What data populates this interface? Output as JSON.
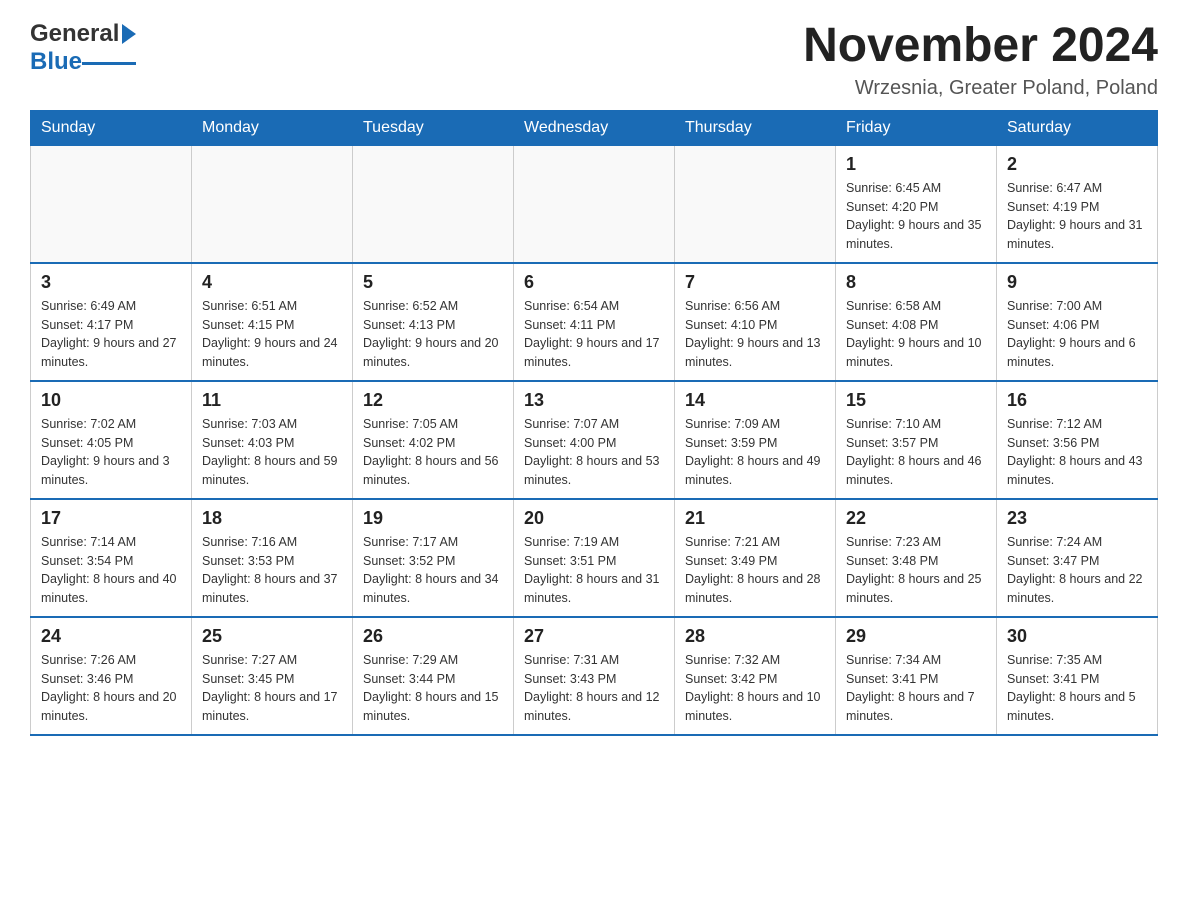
{
  "header": {
    "logo_general": "General",
    "logo_blue": "Blue",
    "title": "November 2024",
    "subtitle": "Wrzesnia, Greater Poland, Poland"
  },
  "weekdays": [
    "Sunday",
    "Monday",
    "Tuesday",
    "Wednesday",
    "Thursday",
    "Friday",
    "Saturday"
  ],
  "weeks": [
    [
      {
        "day": "",
        "info": ""
      },
      {
        "day": "",
        "info": ""
      },
      {
        "day": "",
        "info": ""
      },
      {
        "day": "",
        "info": ""
      },
      {
        "day": "",
        "info": ""
      },
      {
        "day": "1",
        "info": "Sunrise: 6:45 AM\nSunset: 4:20 PM\nDaylight: 9 hours and 35 minutes."
      },
      {
        "day": "2",
        "info": "Sunrise: 6:47 AM\nSunset: 4:19 PM\nDaylight: 9 hours and 31 minutes."
      }
    ],
    [
      {
        "day": "3",
        "info": "Sunrise: 6:49 AM\nSunset: 4:17 PM\nDaylight: 9 hours and 27 minutes."
      },
      {
        "day": "4",
        "info": "Sunrise: 6:51 AM\nSunset: 4:15 PM\nDaylight: 9 hours and 24 minutes."
      },
      {
        "day": "5",
        "info": "Sunrise: 6:52 AM\nSunset: 4:13 PM\nDaylight: 9 hours and 20 minutes."
      },
      {
        "day": "6",
        "info": "Sunrise: 6:54 AM\nSunset: 4:11 PM\nDaylight: 9 hours and 17 minutes."
      },
      {
        "day": "7",
        "info": "Sunrise: 6:56 AM\nSunset: 4:10 PM\nDaylight: 9 hours and 13 minutes."
      },
      {
        "day": "8",
        "info": "Sunrise: 6:58 AM\nSunset: 4:08 PM\nDaylight: 9 hours and 10 minutes."
      },
      {
        "day": "9",
        "info": "Sunrise: 7:00 AM\nSunset: 4:06 PM\nDaylight: 9 hours and 6 minutes."
      }
    ],
    [
      {
        "day": "10",
        "info": "Sunrise: 7:02 AM\nSunset: 4:05 PM\nDaylight: 9 hours and 3 minutes."
      },
      {
        "day": "11",
        "info": "Sunrise: 7:03 AM\nSunset: 4:03 PM\nDaylight: 8 hours and 59 minutes."
      },
      {
        "day": "12",
        "info": "Sunrise: 7:05 AM\nSunset: 4:02 PM\nDaylight: 8 hours and 56 minutes."
      },
      {
        "day": "13",
        "info": "Sunrise: 7:07 AM\nSunset: 4:00 PM\nDaylight: 8 hours and 53 minutes."
      },
      {
        "day": "14",
        "info": "Sunrise: 7:09 AM\nSunset: 3:59 PM\nDaylight: 8 hours and 49 minutes."
      },
      {
        "day": "15",
        "info": "Sunrise: 7:10 AM\nSunset: 3:57 PM\nDaylight: 8 hours and 46 minutes."
      },
      {
        "day": "16",
        "info": "Sunrise: 7:12 AM\nSunset: 3:56 PM\nDaylight: 8 hours and 43 minutes."
      }
    ],
    [
      {
        "day": "17",
        "info": "Sunrise: 7:14 AM\nSunset: 3:54 PM\nDaylight: 8 hours and 40 minutes."
      },
      {
        "day": "18",
        "info": "Sunrise: 7:16 AM\nSunset: 3:53 PM\nDaylight: 8 hours and 37 minutes."
      },
      {
        "day": "19",
        "info": "Sunrise: 7:17 AM\nSunset: 3:52 PM\nDaylight: 8 hours and 34 minutes."
      },
      {
        "day": "20",
        "info": "Sunrise: 7:19 AM\nSunset: 3:51 PM\nDaylight: 8 hours and 31 minutes."
      },
      {
        "day": "21",
        "info": "Sunrise: 7:21 AM\nSunset: 3:49 PM\nDaylight: 8 hours and 28 minutes."
      },
      {
        "day": "22",
        "info": "Sunrise: 7:23 AM\nSunset: 3:48 PM\nDaylight: 8 hours and 25 minutes."
      },
      {
        "day": "23",
        "info": "Sunrise: 7:24 AM\nSunset: 3:47 PM\nDaylight: 8 hours and 22 minutes."
      }
    ],
    [
      {
        "day": "24",
        "info": "Sunrise: 7:26 AM\nSunset: 3:46 PM\nDaylight: 8 hours and 20 minutes."
      },
      {
        "day": "25",
        "info": "Sunrise: 7:27 AM\nSunset: 3:45 PM\nDaylight: 8 hours and 17 minutes."
      },
      {
        "day": "26",
        "info": "Sunrise: 7:29 AM\nSunset: 3:44 PM\nDaylight: 8 hours and 15 minutes."
      },
      {
        "day": "27",
        "info": "Sunrise: 7:31 AM\nSunset: 3:43 PM\nDaylight: 8 hours and 12 minutes."
      },
      {
        "day": "28",
        "info": "Sunrise: 7:32 AM\nSunset: 3:42 PM\nDaylight: 8 hours and 10 minutes."
      },
      {
        "day": "29",
        "info": "Sunrise: 7:34 AM\nSunset: 3:41 PM\nDaylight: 8 hours and 7 minutes."
      },
      {
        "day": "30",
        "info": "Sunrise: 7:35 AM\nSunset: 3:41 PM\nDaylight: 8 hours and 5 minutes."
      }
    ]
  ]
}
